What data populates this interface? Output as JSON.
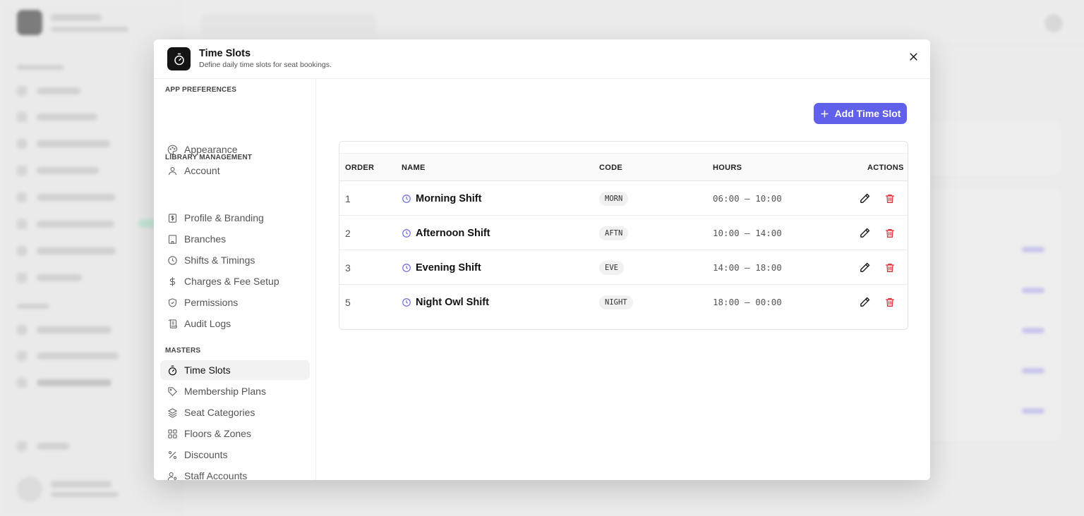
{
  "modal": {
    "title": "Time Slots",
    "subtitle": "Define daily time slots for seat bookings."
  },
  "sidebar": {
    "sections": [
      {
        "heading": "APP PREFERENCES",
        "items": [
          {
            "label": "Appearance",
            "icon": "palette-icon"
          },
          {
            "label": "Account",
            "icon": "user-icon"
          }
        ]
      },
      {
        "heading": "LIBRARY MANAGEMENT",
        "items": [
          {
            "label": "Profile & Branding",
            "icon": "badge-icon"
          },
          {
            "label": "Branches",
            "icon": "building-icon"
          },
          {
            "label": "Shifts & Timings",
            "icon": "clock-icon"
          },
          {
            "label": "Charges & Fee Setup",
            "icon": "dollar-icon"
          },
          {
            "label": "Permissions",
            "icon": "shield-icon"
          },
          {
            "label": "Audit Logs",
            "icon": "scroll-icon"
          }
        ]
      },
      {
        "heading": "MASTERS",
        "items": [
          {
            "label": "Time Slots",
            "icon": "timer-icon",
            "active": true
          },
          {
            "label": "Membership Plans",
            "icon": "tag-icon"
          },
          {
            "label": "Seat Categories",
            "icon": "layers-icon"
          },
          {
            "label": "Floors & Zones",
            "icon": "grid-icon"
          },
          {
            "label": "Discounts",
            "icon": "percent-icon"
          },
          {
            "label": "Staff Accounts",
            "icon": "user-cog-icon"
          }
        ]
      }
    ]
  },
  "toolbar": {
    "add_label": "Add Time Slot"
  },
  "table": {
    "headers": {
      "order": "ORDER",
      "name": "NAME",
      "code": "CODE",
      "hours": "HOURS",
      "actions": "ACTIONS"
    },
    "rows": [
      {
        "order": "1",
        "name": "Morning Shift",
        "code": "MORN",
        "hours": "06:00 – 10:00"
      },
      {
        "order": "2",
        "name": "Afternoon Shift",
        "code": "AFTN",
        "hours": "10:00 – 14:00"
      },
      {
        "order": "3",
        "name": "Evening Shift",
        "code": "EVE",
        "hours": "14:00 – 18:00"
      },
      {
        "order": "5",
        "name": "Night Owl Shift",
        "code": "NIGHT",
        "hours": "18:00 – 00:00"
      }
    ]
  },
  "colors": {
    "accent": "#6160ea",
    "danger": "#e0313b",
    "clock_icon": "#6a67e6"
  }
}
